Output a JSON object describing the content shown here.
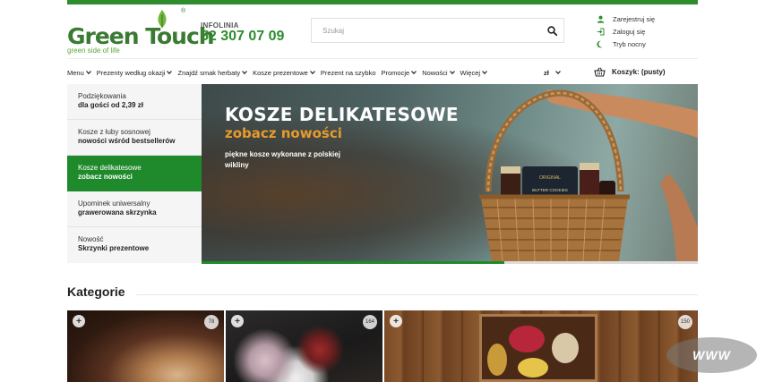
{
  "brand": {
    "logo_text_1": "Green ",
    "logo_text_2": "Touch",
    "registered": "®",
    "tagline": "green side of life"
  },
  "contact": {
    "label": "INFOLINIA",
    "phone": "52 307 07 09"
  },
  "search": {
    "placeholder": "Szukaj",
    "value": ""
  },
  "account": {
    "register": "Zarejestruj się",
    "login": "Zaloguj się",
    "night_mode": "Tryb nocny"
  },
  "nav": {
    "items": [
      {
        "label": "Menu",
        "dropdown": true
      },
      {
        "label": "Prezenty według okazji",
        "dropdown": true
      },
      {
        "label": "Znajdź smak herbaty",
        "dropdown": true
      },
      {
        "label": "Kosze prezentowe",
        "dropdown": true
      },
      {
        "label": "Prezent na szybko",
        "dropdown": false
      },
      {
        "label": "Promocje",
        "dropdown": true
      },
      {
        "label": "Nowości",
        "dropdown": true
      },
      {
        "label": "Więcej",
        "dropdown": true
      }
    ],
    "currency": "zł",
    "cart_label": "Koszyk: (pusty)"
  },
  "slider": {
    "menu": [
      {
        "line1": "Podziękowania",
        "line2": "dla gości od 2,39 zł",
        "active": false
      },
      {
        "line1": "Kosze z łuby sosnowej",
        "line2": "nowości wśród bestsellerów",
        "active": false
      },
      {
        "line1": "Kosze delikatesowe",
        "line2": "zobacz nowości",
        "active": true
      },
      {
        "line1": "Upominek uniwersalny",
        "line2": "grawerowana skrzynka",
        "active": false
      },
      {
        "line1": "Nowość",
        "line2": "Skrzynki prezentowe",
        "active": false
      }
    ],
    "banner": {
      "title": "KOSZE DELIKATESOWE",
      "subtitle": "zobacz nowości",
      "description": "piękne kosze wykonane z polskiej wikliny",
      "jar_label_1": "ORIGINAL",
      "jar_label_2": "BUTTER COOKIES"
    },
    "progress": 0.61
  },
  "categories": {
    "title": "Kategorie",
    "tiles": [
      {
        "count": "78"
      },
      {
        "count": "164"
      },
      {
        "count": "150"
      }
    ]
  },
  "watermark": "WWW",
  "colors": {
    "brand_green": "#2e8b2e",
    "active_green": "#1f8a2c",
    "accent_orange": "#e89a2b"
  }
}
